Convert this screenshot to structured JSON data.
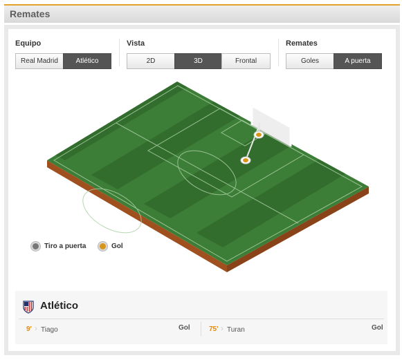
{
  "header": {
    "title": "Remates"
  },
  "controls": {
    "equipo": {
      "label": "Equipo",
      "options": [
        "Real Madrid",
        "Atlético"
      ],
      "selected": "Atlético"
    },
    "vista": {
      "label": "Vista",
      "options": [
        "2D",
        "3D",
        "Frontal"
      ],
      "selected": "3D"
    },
    "remates": {
      "label": "Remates",
      "options": [
        "Goles",
        "A puerta"
      ],
      "selected": "A puerta"
    }
  },
  "legend": [
    {
      "label": "Tiro a puerta",
      "color": "#777777"
    },
    {
      "label": "Gol",
      "color": "#d7951c"
    }
  ],
  "team": {
    "name": "Atlético",
    "events": [
      {
        "minute": "9'",
        "player": "Tiago",
        "type": "Gol"
      },
      {
        "minute": "75'",
        "player": "Turan",
        "type": "Gol"
      }
    ]
  },
  "colors": {
    "accent": "#e3a329",
    "pitch_light": "#3c7d37",
    "pitch_dark": "#336d2e",
    "soil": "#a0501e",
    "goal_marker": "#d7951c"
  }
}
